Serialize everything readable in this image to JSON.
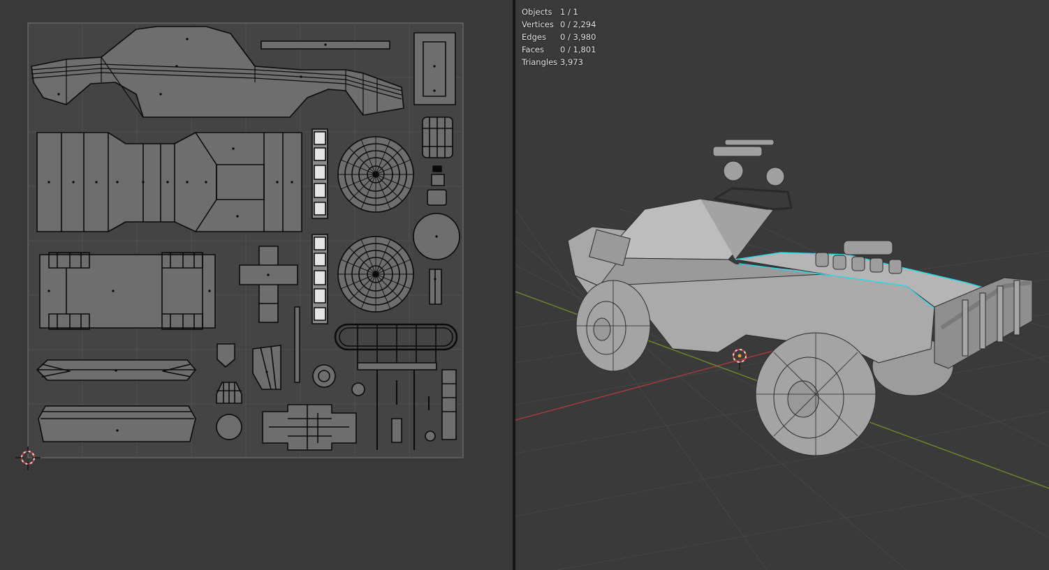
{
  "colors": {
    "editor_bg": "#393939",
    "uv_background": "#444444",
    "uv_face": "#6e6e6e",
    "uv_edge": "#0a0a0a",
    "grid": "#525252",
    "x_axis": "#b33a3a",
    "y_axis": "#7a9a2a",
    "selection": "#2fd8e8",
    "cursor_red": "#d23b3b"
  },
  "icons": {
    "uv_cursor": "3d-cursor-icon",
    "viewport_cursor": "3d-cursor-icon"
  },
  "viewport": {
    "stats": [
      {
        "label": "Objects",
        "value": "1 / 1"
      },
      {
        "label": "Vertices",
        "value": "0 / 2,294"
      },
      {
        "label": "Edges",
        "value": "0 / 3,980"
      },
      {
        "label": "Faces",
        "value": "0 / 1,801"
      },
      {
        "label": "Triangles",
        "value": "3,973"
      }
    ]
  }
}
